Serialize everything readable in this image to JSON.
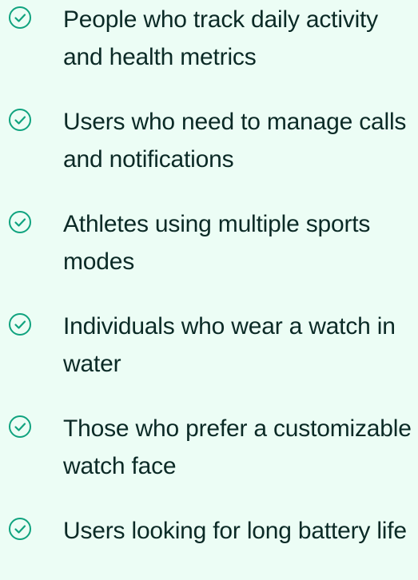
{
  "list": {
    "items": [
      {
        "label": "People who track daily activity and health metrics",
        "icon": "check-circle-icon"
      },
      {
        "label": "Users who need to manage calls and notifications",
        "icon": "check-circle-icon"
      },
      {
        "label": "Athletes using multiple sports modes",
        "icon": "check-circle-icon"
      },
      {
        "label": "Individuals who wear a watch in water",
        "icon": "check-circle-icon"
      },
      {
        "label": "Those who prefer a customizable watch face",
        "icon": "check-circle-icon"
      },
      {
        "label": "Users looking for long battery life",
        "icon": "check-circle-icon"
      }
    ],
    "accent_color": "#10a37f",
    "text_color": "#0b2a26",
    "background_color": "#ecfdf5"
  }
}
